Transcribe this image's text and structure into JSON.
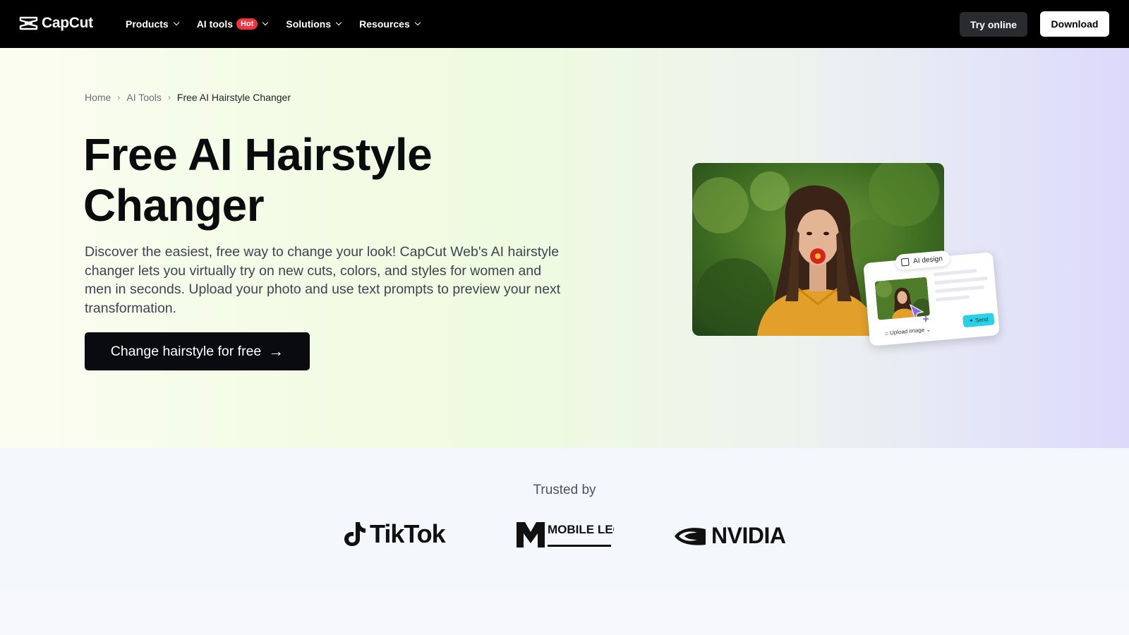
{
  "brand": {
    "name": "CapCut"
  },
  "nav": {
    "items": [
      {
        "label": "Products"
      },
      {
        "label": "AI tools",
        "badge": "Hot"
      },
      {
        "label": "Solutions"
      },
      {
        "label": "Resources"
      }
    ],
    "try_online": "Try online",
    "download": "Download"
  },
  "breadcrumb": {
    "home": "Home",
    "ai_tools": "AI Tools",
    "current": "Free AI Hairstyle Changer"
  },
  "hero": {
    "title": "Free AI Hairstyle Changer",
    "description": "Discover the easiest, free way to change your look! CapCut Web's AI hairstyle changer lets you virtually try on new cuts, colors, and styles for women and men in seconds. Upload your photo and use text prompts to preview your next transformation.",
    "cta": "Change hairstyle for free",
    "card": {
      "pill": "AI design",
      "upload": "Upload image",
      "send": "Send"
    }
  },
  "trusted": {
    "label": "Trusted by",
    "logos": [
      "TikTok",
      "MOBILE LEGENDS",
      "NVIDIA"
    ]
  },
  "colors": {
    "nav_bg": "#000000",
    "hot": "#f5333f",
    "cta_bg": "#0a0b0f",
    "send": "#28d1e6"
  }
}
